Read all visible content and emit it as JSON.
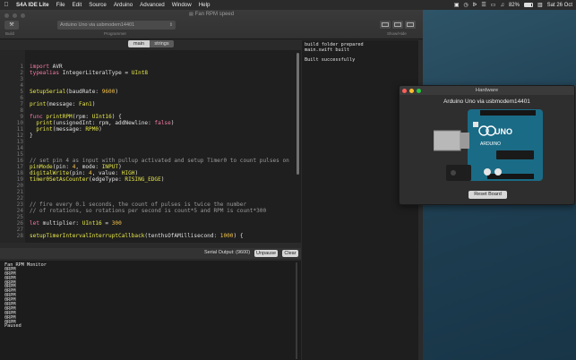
{
  "menubar": {
    "app_name": "S4A IDE Lite",
    "items": [
      "File",
      "Edit",
      "Source",
      "Arduino",
      "Advanced",
      "Window",
      "Help"
    ],
    "battery_percent": "82%",
    "clock": "Sat 26 Oct"
  },
  "window": {
    "title": "Fan RPM speed",
    "build_label": "Build",
    "programmer_value": "Arduino Uno via usbmodem14401",
    "programmer_label": "Programmer",
    "showhide_label": "Show/Hide"
  },
  "tabs": [
    {
      "label": "main",
      "active": true
    },
    {
      "label": "strings",
      "active": false
    }
  ],
  "editor": {
    "lines": [
      {
        "n": "1",
        "parts": [
          [
            "kw",
            "import"
          ],
          [
            "",
            " AVR"
          ]
        ]
      },
      {
        "n": "2",
        "parts": [
          [
            "kw",
            "typealias"
          ],
          [
            "",
            " IntegerLiteralType = "
          ],
          [
            "ty",
            "UInt8"
          ]
        ]
      },
      {
        "n": "3",
        "parts": []
      },
      {
        "n": "4",
        "parts": []
      },
      {
        "n": "5",
        "parts": [
          [
            "fn",
            "SetupSerial"
          ],
          [
            "",
            "(baudRate: "
          ],
          [
            "num",
            "9600"
          ],
          [
            "",
            ")"
          ]
        ]
      },
      {
        "n": "6",
        "parts": []
      },
      {
        "n": "7",
        "parts": [
          [
            "fn",
            "print"
          ],
          [
            "",
            "(message: "
          ],
          [
            "fn",
            "Fan1"
          ],
          [
            "",
            ")"
          ]
        ]
      },
      {
        "n": "8",
        "parts": []
      },
      {
        "n": "9",
        "parts": [
          [
            "kw",
            "func"
          ],
          [
            "",
            " "
          ],
          [
            "fn",
            "printRPM"
          ],
          [
            "",
            "(rpm: "
          ],
          [
            "ty",
            "UInt16"
          ],
          [
            "",
            ") {"
          ]
        ]
      },
      {
        "n": "10",
        "parts": [
          [
            "",
            "  "
          ],
          [
            "fn",
            "print"
          ],
          [
            "",
            "(unsignedInt: rpm, addNewline: "
          ],
          [
            "kw",
            "false"
          ],
          [
            "",
            ")"
          ]
        ]
      },
      {
        "n": "11",
        "parts": [
          [
            "",
            "  "
          ],
          [
            "fn",
            "print"
          ],
          [
            "",
            "(message: "
          ],
          [
            "fn",
            "RPM0"
          ],
          [
            "",
            ")"
          ]
        ]
      },
      {
        "n": "12",
        "parts": [
          [
            "",
            "}"
          ]
        ]
      },
      {
        "n": "13",
        "parts": []
      },
      {
        "n": "14",
        "parts": []
      },
      {
        "n": "15",
        "parts": []
      },
      {
        "n": "16",
        "parts": [
          [
            "cm",
            "// set pin 4 as input with pullup activated and setup Timer0 to count pulses on"
          ]
        ]
      },
      {
        "n": "17",
        "parts": [
          [
            "fn",
            "pinMode"
          ],
          [
            "",
            "(pin: "
          ],
          [
            "num",
            "4"
          ],
          [
            "",
            ", mode: "
          ],
          [
            "ty",
            "INPUT"
          ],
          [
            "",
            ")"
          ]
        ]
      },
      {
        "n": "18",
        "parts": [
          [
            "fn",
            "digitalWrite"
          ],
          [
            "",
            "(pin: "
          ],
          [
            "num",
            "4"
          ],
          [
            "",
            ", value: "
          ],
          [
            "ty",
            "HIGH"
          ],
          [
            "",
            ")"
          ]
        ]
      },
      {
        "n": "19",
        "parts": [
          [
            "fn",
            "timer0SetAsCounter"
          ],
          [
            "",
            "(edgeType: "
          ],
          [
            "ty",
            "RISING_EDGE"
          ],
          [
            "",
            ")"
          ]
        ]
      },
      {
        "n": "20",
        "parts": []
      },
      {
        "n": "21",
        "parts": []
      },
      {
        "n": "22",
        "parts": []
      },
      {
        "n": "23",
        "parts": [
          [
            "cm",
            "// fire every 0.1 seconds, the count of pulses is twice the number"
          ]
        ]
      },
      {
        "n": "24",
        "parts": [
          [
            "cm",
            "// of rotations, so rotations per second is count*5 and RPM is count*300"
          ]
        ]
      },
      {
        "n": "25",
        "parts": []
      },
      {
        "n": "26",
        "parts": [
          [
            "kw",
            "let"
          ],
          [
            "",
            " multiplier: "
          ],
          [
            "ty",
            "UInt16"
          ],
          [
            "",
            " = "
          ],
          [
            "num",
            "300"
          ]
        ]
      },
      {
        "n": "27",
        "parts": []
      },
      {
        "n": "28",
        "parts": [
          [
            "fn",
            "setupTimerIntervalInterruptCallback"
          ],
          [
            "",
            "(tenthsOfAMillisecond: "
          ],
          [
            "num",
            "1000"
          ],
          [
            "",
            ") {"
          ]
        ]
      }
    ]
  },
  "serial": {
    "label": "Serial Output: (9600)",
    "unpause_label": "Unpause",
    "clear_label": "Clear",
    "lines": [
      "Fan RPM Monitor",
      "0RPM",
      "0RPM",
      "0RPM",
      "0RPM",
      "0RPM",
      "0RPM",
      "0RPM",
      "0RPM",
      "0RPM",
      "0RPM",
      "0RPM",
      "0RPM",
      "0RPM",
      "Paused"
    ]
  },
  "buildlog": {
    "lines": [
      "build folder prepared",
      "main.swift built",
      "",
      "Built successfully"
    ]
  },
  "hardware": {
    "title": "Hardware",
    "board_name": "Arduino Uno via usbmodem14401",
    "reset_label": "Reset Board",
    "board_logo_text": "UNO",
    "board_brand_text": "ARDUINO",
    "colors": {
      "board": "#1a6b86",
      "board_dark": "#0f5068"
    }
  }
}
